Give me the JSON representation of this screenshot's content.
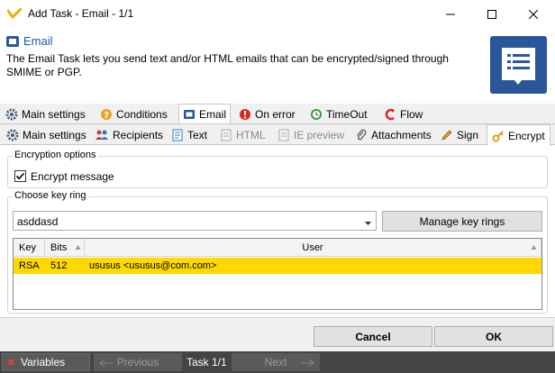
{
  "window": {
    "title": "Add Task - Email - 1/1"
  },
  "header": {
    "title": "Email",
    "description": "The Email Task lets you send text and/or HTML emails that can be encrypted/signed through SMIME or PGP."
  },
  "main_tabs": [
    {
      "label": "Main settings",
      "icon": "gear-icon"
    },
    {
      "label": "Conditions",
      "icon": "question-icon"
    },
    {
      "label": "Email",
      "icon": "email-task-icon",
      "active": true
    },
    {
      "label": "On error",
      "icon": "error-icon"
    },
    {
      "label": "TimeOut",
      "icon": "timeout-icon"
    },
    {
      "label": "Flow",
      "icon": "flow-icon"
    }
  ],
  "sub_tabs": [
    {
      "label": "Main settings",
      "icon": "gear-icon"
    },
    {
      "label": "Recipients",
      "icon": "people-icon"
    },
    {
      "label": "Text",
      "icon": "text-icon"
    },
    {
      "label": "HTML",
      "icon": "html-icon",
      "disabled": true
    },
    {
      "label": "IE preview",
      "icon": "ie-icon",
      "disabled": true
    },
    {
      "label": "Attachments",
      "icon": "paperclip-icon"
    },
    {
      "label": "Sign",
      "icon": "pen-icon"
    },
    {
      "label": "Encrypt",
      "icon": "key-icon",
      "active": true
    }
  ],
  "encryption": {
    "legend": "Encryption options",
    "encrypt_label": "Encrypt message",
    "encrypt_checked": true
  },
  "keyring": {
    "legend": "Choose key ring",
    "selected": "asddasd",
    "manage_label": "Manage key rings",
    "columns": [
      "Key",
      "Bits",
      "User"
    ],
    "rows": [
      {
        "key": "RSA",
        "bits": "512",
        "user": "ususus <ususus@com.com>"
      }
    ]
  },
  "footer": {
    "cancel_label": "Cancel",
    "ok_label": "OK"
  },
  "statusbar": {
    "variables_label": "Variables",
    "previous_label": "Previous",
    "task_label": "Task 1/1",
    "next_label": "Next"
  },
  "colors": {
    "selected_row": "#ffd800",
    "header_title": "#1a5aa6",
    "accent": "#2b579a",
    "statusbar": "#444444"
  }
}
